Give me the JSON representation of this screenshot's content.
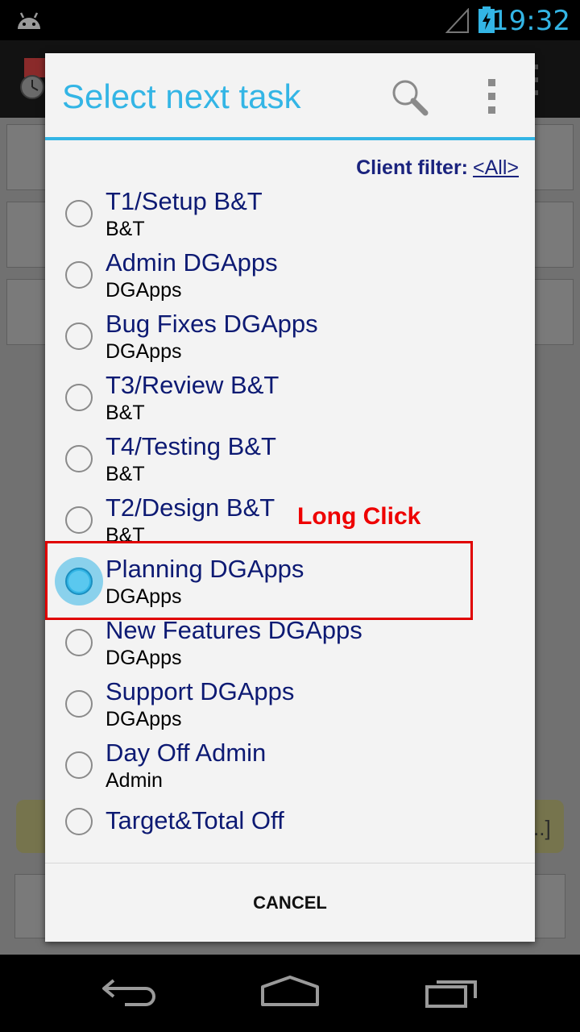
{
  "status_bar": {
    "time": "19:32",
    "icons": [
      "android-icon",
      "signal-icon",
      "battery-charging-icon"
    ]
  },
  "background_app": {
    "link_fragment": "..]"
  },
  "dialog": {
    "title": "Select next task",
    "icons": [
      "search-icon",
      "overflow-menu-icon"
    ],
    "client_filter": {
      "label": "Client filter:",
      "value": "<All>"
    },
    "tasks": [
      {
        "title": "T1/Setup B&T",
        "client": "B&T",
        "checked": false
      },
      {
        "title": "Admin DGApps",
        "client": "DGApps",
        "checked": false
      },
      {
        "title": "Bug Fixes DGApps",
        "client": "DGApps",
        "checked": false
      },
      {
        "title": "T3/Review B&T",
        "client": "B&T",
        "checked": false
      },
      {
        "title": "T4/Testing B&T",
        "client": "B&T",
        "checked": false
      },
      {
        "title": "T2/Design B&T",
        "client": "B&T",
        "checked": false
      },
      {
        "title": "Planning DGApps",
        "client": "DGApps",
        "checked": true
      },
      {
        "title": "New Features DGApps",
        "client": "DGApps",
        "checked": false
      },
      {
        "title": "Support DGApps",
        "client": "DGApps",
        "checked": false
      },
      {
        "title": "Day Off Admin",
        "client": "Admin",
        "checked": false
      },
      {
        "title": "Target&Total Off",
        "client": "",
        "checked": false
      }
    ],
    "annotation": "Long Click",
    "cancel_label": "CANCEL"
  },
  "colors": {
    "accent": "#33b5e5",
    "task_title": "#0d1a73",
    "annotation": "#ee0000"
  },
  "nav_bar": {
    "icons": [
      "back-icon",
      "home-icon",
      "recent-apps-icon"
    ]
  }
}
